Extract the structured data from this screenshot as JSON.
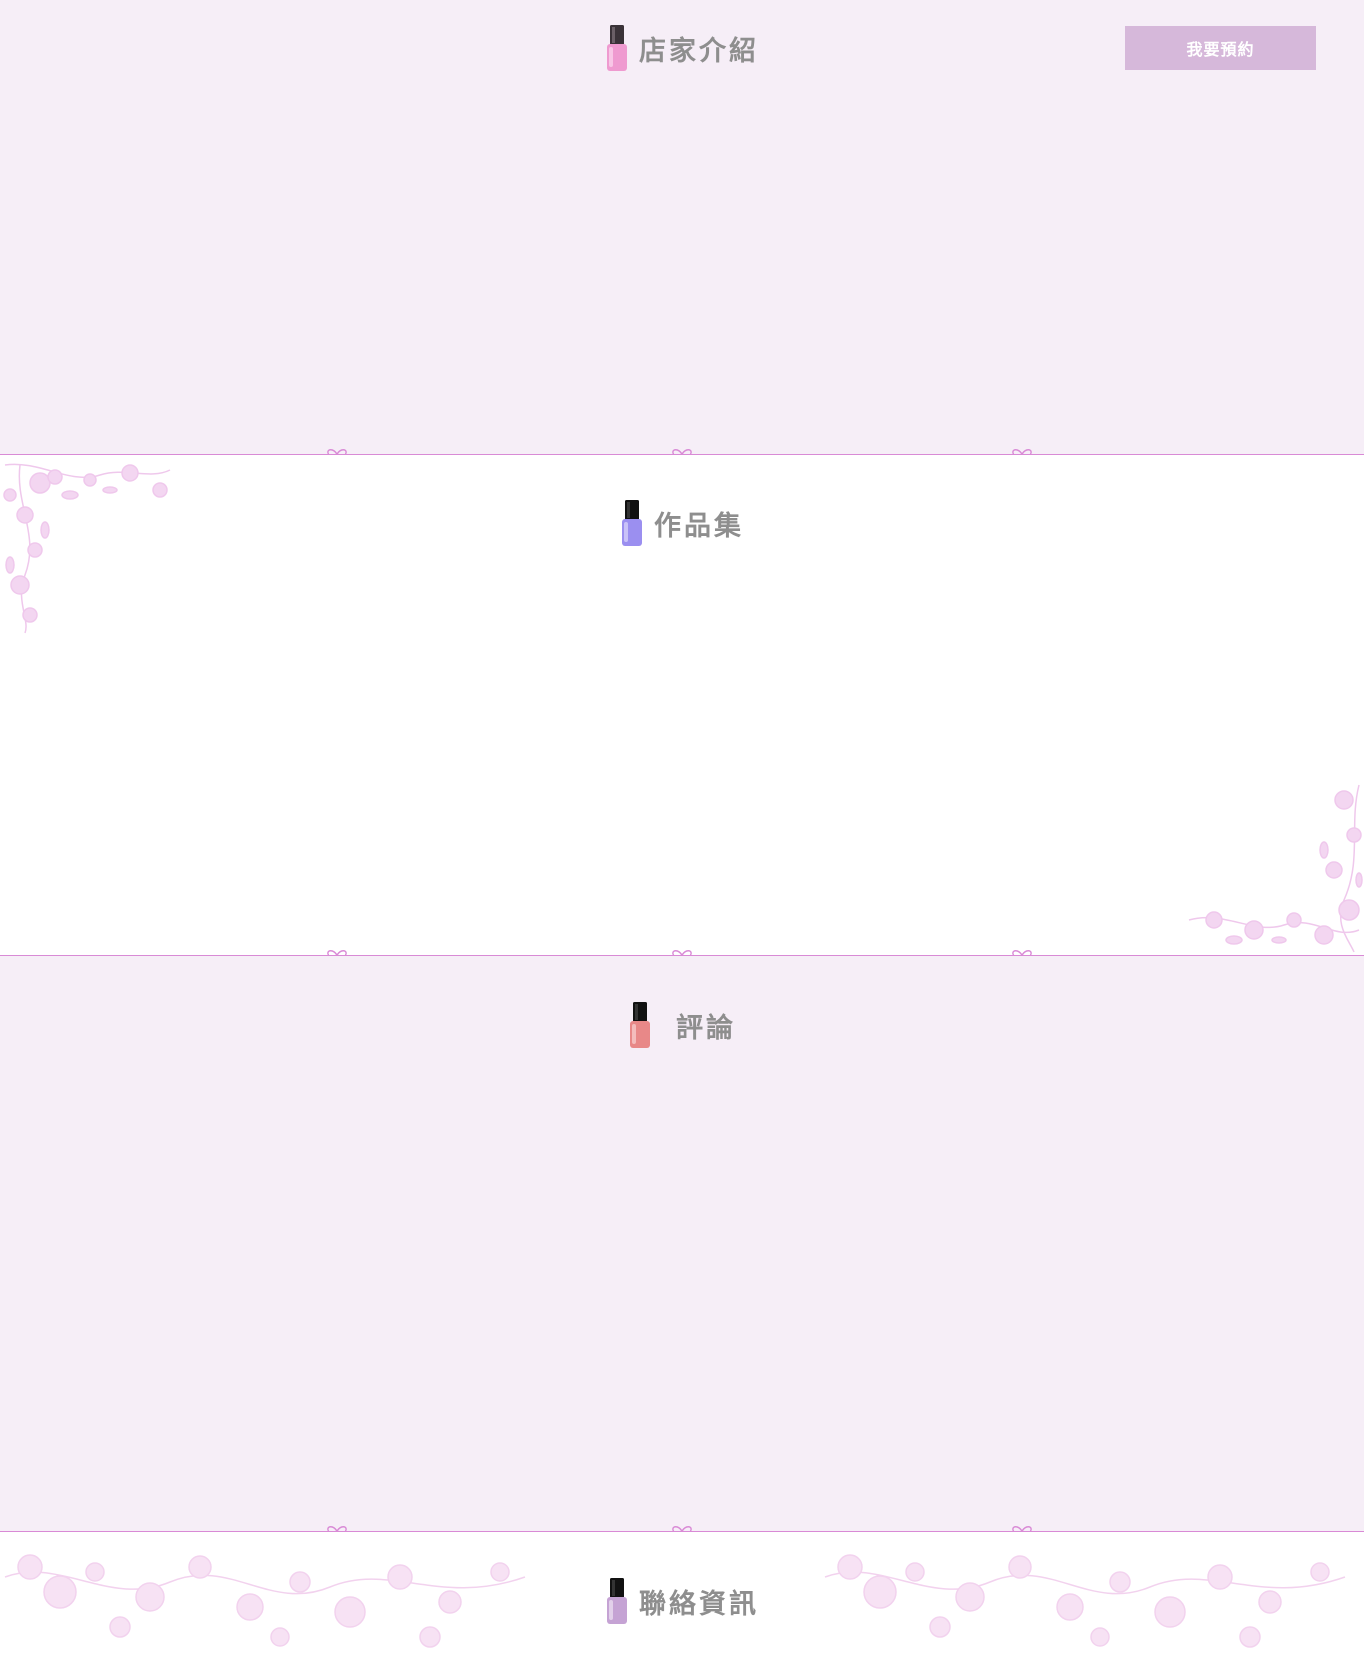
{
  "header": {
    "reserve_button": "我要預約"
  },
  "sections": {
    "intro": {
      "title": "店家介紹",
      "icon": "pink-nail-polish-icon",
      "polish_color": "#ef9ad0"
    },
    "works": {
      "title": "作品集",
      "icon": "purple-nail-polish-icon",
      "polish_color": "#9b8ff0"
    },
    "reviews": {
      "title": "評論",
      "icon": "coral-nail-polish-icon",
      "polish_color": "#e88888"
    },
    "contact": {
      "title": "聯絡資訊",
      "icon": "lilac-nail-polish-icon",
      "polish_color": "#c5a3d4"
    }
  },
  "colors": {
    "lilac_background": "#f6eef7",
    "divider": "#d98ad6",
    "button": "#d6b8da",
    "title_text": "#8e8e8e",
    "floral": "#f3d6f1"
  }
}
